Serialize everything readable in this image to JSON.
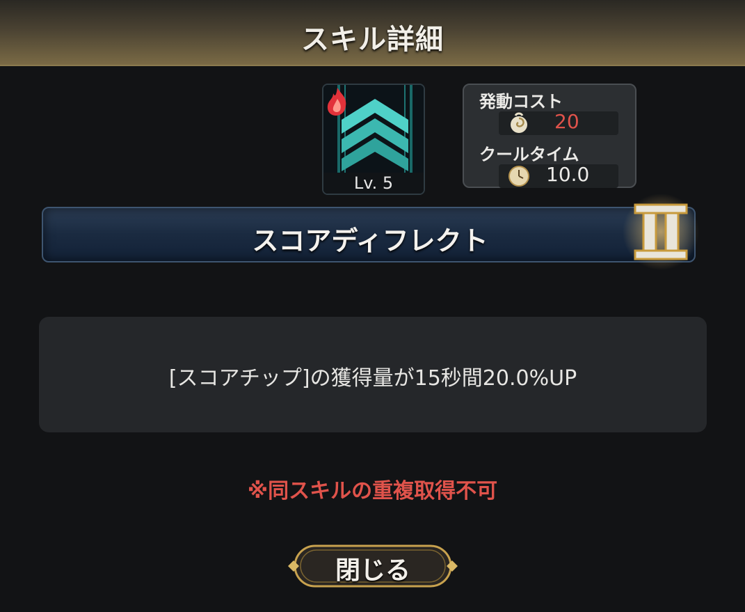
{
  "header": {
    "title": "スキル詳細"
  },
  "skill": {
    "level": "Lv. 5",
    "icon": "teal-chevron-icon",
    "element_icon": "fire-icon",
    "name": "スコアディフレクト",
    "rank": "II"
  },
  "stats": {
    "cost_label": "発動コスト",
    "cost_icon": "coin-swirl-icon",
    "cost_value": "20",
    "cooldown_label": "クールタイム",
    "cooldown_icon": "clock-icon",
    "cooldown_value": "10.0"
  },
  "description": "[スコアチップ]の獲得量が15秒間20.0%UP",
  "note": "※同スキルの重複取得不可",
  "close_button": {
    "label": "閉じる"
  },
  "colors": {
    "accent_gold": "#c8a24e",
    "cost_red": "#e0534b",
    "skill_teal": "#38c7c0"
  }
}
